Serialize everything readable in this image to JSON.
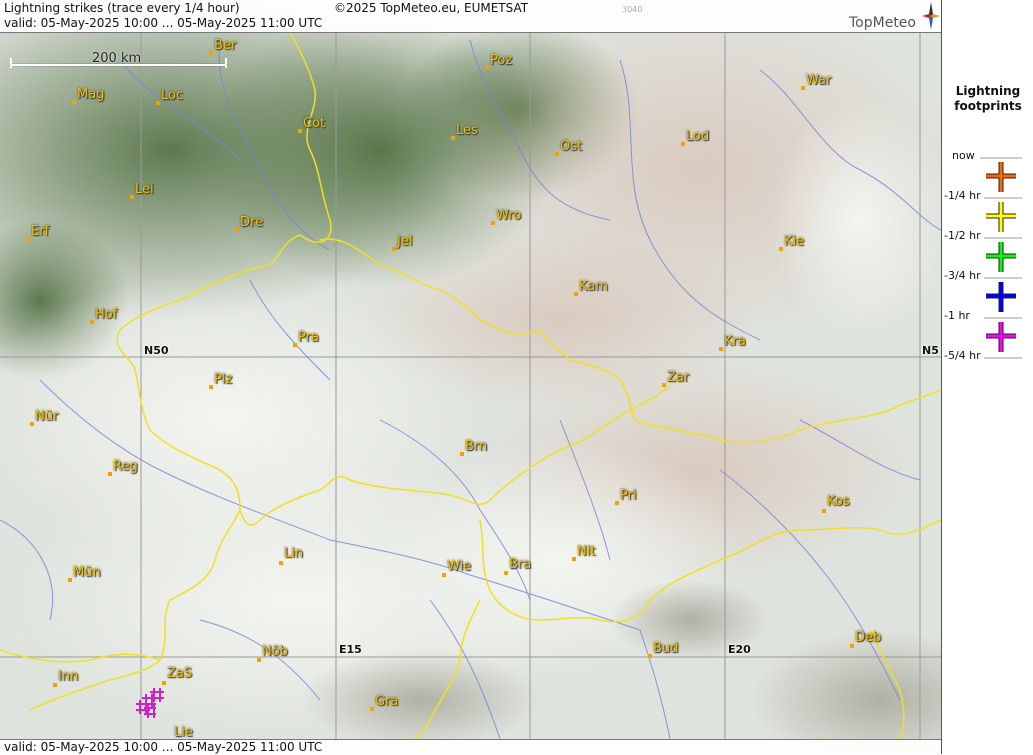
{
  "header": {
    "title": "Lightning strikes (trace every 1/4 hour)",
    "valid": "valid:  05-May-2025 10:00 ... 05-May-2025 11:00 UTC",
    "copyright": "©2025 TopMeteo.eu, EUMETSAT",
    "code": "3040",
    "brand": "TopMeteo"
  },
  "footer": {
    "valid": "valid:  05-May-2025 10:00 ... 05-May-2025 11:00 UTC"
  },
  "scale": {
    "label": "200 km"
  },
  "grid": {
    "n50": "N50",
    "n5": "N5",
    "e15": "E15",
    "e20": "E20"
  },
  "cities": {
    "ber": "Ber",
    "poz": "Poz",
    "war": "War",
    "mag": "Mag",
    "loc": "Loc",
    "cot": "Cot",
    "les": "Les",
    "lod": "Lod",
    "ost": "Ost",
    "lei": "Lei",
    "wro": "Wro",
    "dre": "Dre",
    "erf": "Erf",
    "jel": "Jel",
    "kie": "Kie",
    "kam": "Kam",
    "hof": "Hof",
    "pra": "Pra",
    "kra": "Kra",
    "zar": "Zar",
    "plz": "Plz",
    "nur": "Nür",
    "brn": "Brn",
    "reg": "Reg",
    "pri": "Pri",
    "kos": "Kos",
    "lin": "Lin",
    "mun": "Mün",
    "wie": "Wie",
    "bra": "Bra",
    "nit": "Nit",
    "deb": "Deb",
    "nob": "Nöb",
    "bud": "Bud",
    "zas": "ZaS",
    "inn": "Inn",
    "gra": "Gra",
    "lie": "Lie"
  },
  "legend": {
    "title_1": "Lightning",
    "title_2": "footprints",
    "now": "now",
    "q1": "-1/4 hr",
    "q2": "-1/2 hr",
    "q3": "-3/4 hr",
    "q4": "-1 hr",
    "q5": "-5/4 hr"
  },
  "colors": {
    "now": "#ff6600",
    "q1": "#ffff00",
    "q2": "#00ff00",
    "q3": "#0000ff",
    "q4": "#ff00ff",
    "border": "#f0e020",
    "river": "#7a84d8",
    "strikes": "#cc22cc"
  }
}
